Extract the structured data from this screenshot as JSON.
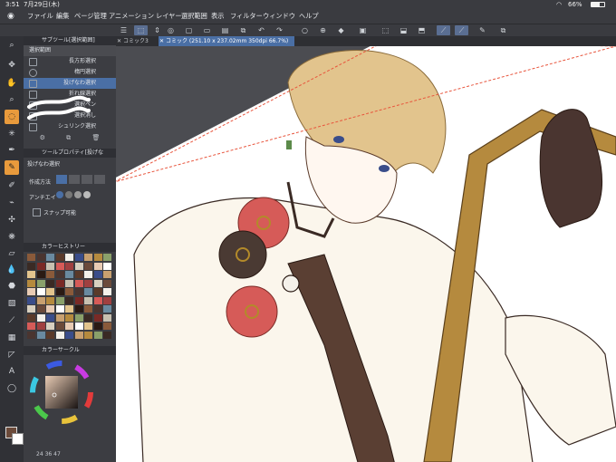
{
  "status": {
    "time": "3:51",
    "date": "7月29日(木)",
    "battery": "66%"
  },
  "menu": [
    "ファイル",
    "編集",
    "ページ管理",
    "アニメーション",
    "レイヤー",
    "選択範囲",
    "表示",
    "フィルター",
    "ウィンドウ",
    "ヘルプ"
  ],
  "tabs": [
    {
      "label": "コミック3",
      "active": false
    },
    {
      "label": "コミック (251.10 x 237.02mm 350dpi 66.7%)",
      "active": true
    }
  ],
  "subtool_panel": {
    "title": "サブツール[選択範囲]",
    "group": "選択範囲",
    "items": [
      "長方形選択",
      "楕円選択",
      "投げなわ選択",
      "折れ線選択",
      "選択ペン",
      "選択消し",
      "シュリンク選択"
    ],
    "active_index": 2
  },
  "tool_property": {
    "title": "ツールプロパティ[投げな",
    "name": "投げなわ選択",
    "mode_label": "作成方法",
    "antialias_label": "アンチエイ",
    "snap_label": "スナップ可能"
  },
  "color_history": {
    "title": "カラーヒストリー"
  },
  "color_wheel": {
    "title": "カラーサークル",
    "values": [
      "24",
      "36",
      "47"
    ]
  },
  "colors": {
    "accent": "#4a6fa5",
    "active_tool": "#e89a3c",
    "selection_border": "#e8553d"
  }
}
